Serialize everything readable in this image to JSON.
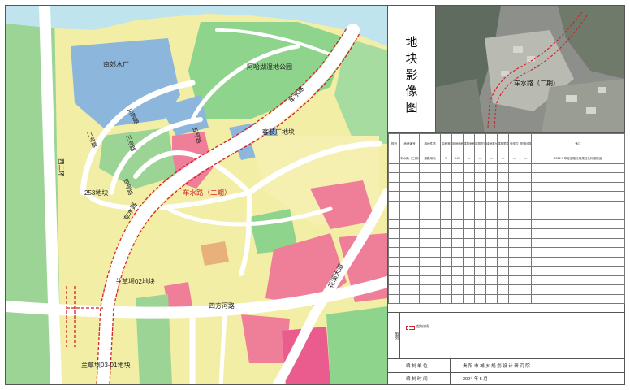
{
  "map_labels": {
    "nanjiao_shuichang": "南郊水厂",
    "aha_park": "阿哈湖湿地公园",
    "road_chexuan_top": "车水路",
    "chuanqi_road": "川黔路",
    "wuhao_road": "五号路",
    "keshenchang": "客装厂地块",
    "er_road": "二号路",
    "san_road": "三号路",
    "xierhuan": "西二环",
    "plot_253": "253地块",
    "sihao_road": "四号路",
    "highlight_road": "车水路（二期）",
    "road_chexuan_mid": "车水路",
    "lancaoba02": "兰草坝02地块",
    "huaxi_avenue": "花溪大道",
    "sifang_road": "四方河路",
    "lancaoba0301": "兰草坝03-01地块"
  },
  "panel": {
    "title_chars": [
      "地",
      "块",
      "影",
      "像",
      "图"
    ],
    "photo_label": "车水路（二期）"
  },
  "table": {
    "side_label": "规划",
    "headers": [
      "地块编号",
      "用地性质",
      "容积率",
      "用地面积(公顷)",
      "建筑面积",
      "建筑密度%",
      "绿地率%",
      "建筑限高(m)",
      "停车位",
      "配套设施",
      "备注"
    ],
    "row": [
      "车水路（二期）",
      "道路用地",
      "S",
      "6.27",
      "—",
      "—",
      "—",
      "—",
      "—",
      "—",
      "2022.9 审定道路红线规划及标准断面"
    ]
  },
  "legend": {
    "title": "图例",
    "item": "道路红线"
  },
  "footer": {
    "unit_key": "编 制 单 位",
    "unit_val": "贵 阳 市 城 乡 规 划 设 计 研 究 院",
    "time_key": "编 制 时 间",
    "time_val": "2024 年 5 月"
  },
  "colors": {
    "residential": "#f5f0a6",
    "green": "#8fd48c",
    "water": "#a6d8e8",
    "utility": "#8fb8dd",
    "commercial": "#f07b97",
    "industrial": "#c9a36b",
    "road": "#ffffff",
    "redline": "#d4232a"
  }
}
